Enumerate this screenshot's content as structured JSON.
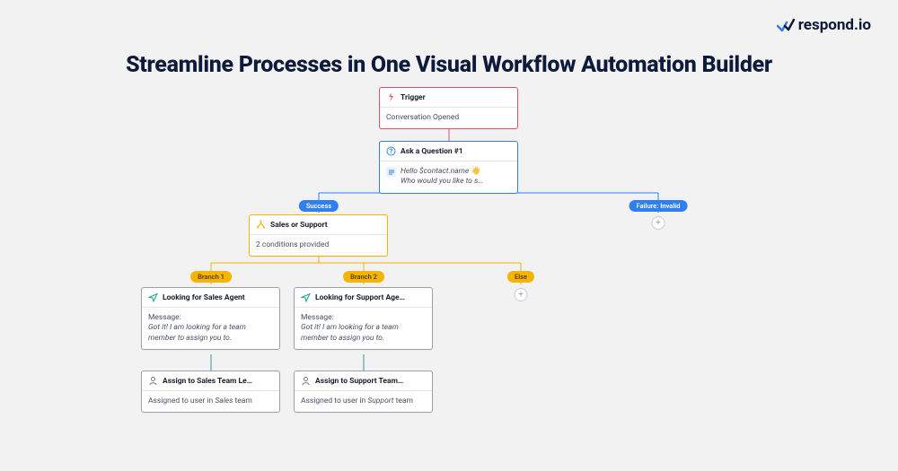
{
  "brand": "respond.io",
  "page_title": "Streamline Processes in One Visual Workflow Automation Builder",
  "trigger": {
    "title": "Trigger",
    "subtitle": "Conversation Opened"
  },
  "question": {
    "title": "Ask a Question #1",
    "line1": "Hello $contact.name 👋",
    "line2": "Who would you like to s…"
  },
  "q_success_label": "Success",
  "q_failure_label": "Failure: Invalid",
  "branch_node": {
    "title": "Sales or Support",
    "subtitle": "2 conditions provided"
  },
  "branch1_label": "Branch 1",
  "branch2_label": "Branch 2",
  "else_label": "Else",
  "sales_msg": {
    "title": "Looking for Sales Agent",
    "msg_label": "Message:",
    "msg_body": "Got it! I am looking for a team member to assign you to."
  },
  "support_msg": {
    "title": "Looking for Support Age…",
    "msg_label": "Message:",
    "msg_body": "Got it! I am looking for a team member to assign you to."
  },
  "sales_assign": {
    "title": "Assign to Sales Team Le…",
    "body_a": "Assigned to user in ",
    "body_b": "Sales",
    "body_c": " team"
  },
  "support_assign": {
    "title": "Assign to Support Team…",
    "body_a": "Assigned to user in ",
    "body_b": "Support",
    "body_c": " team"
  }
}
